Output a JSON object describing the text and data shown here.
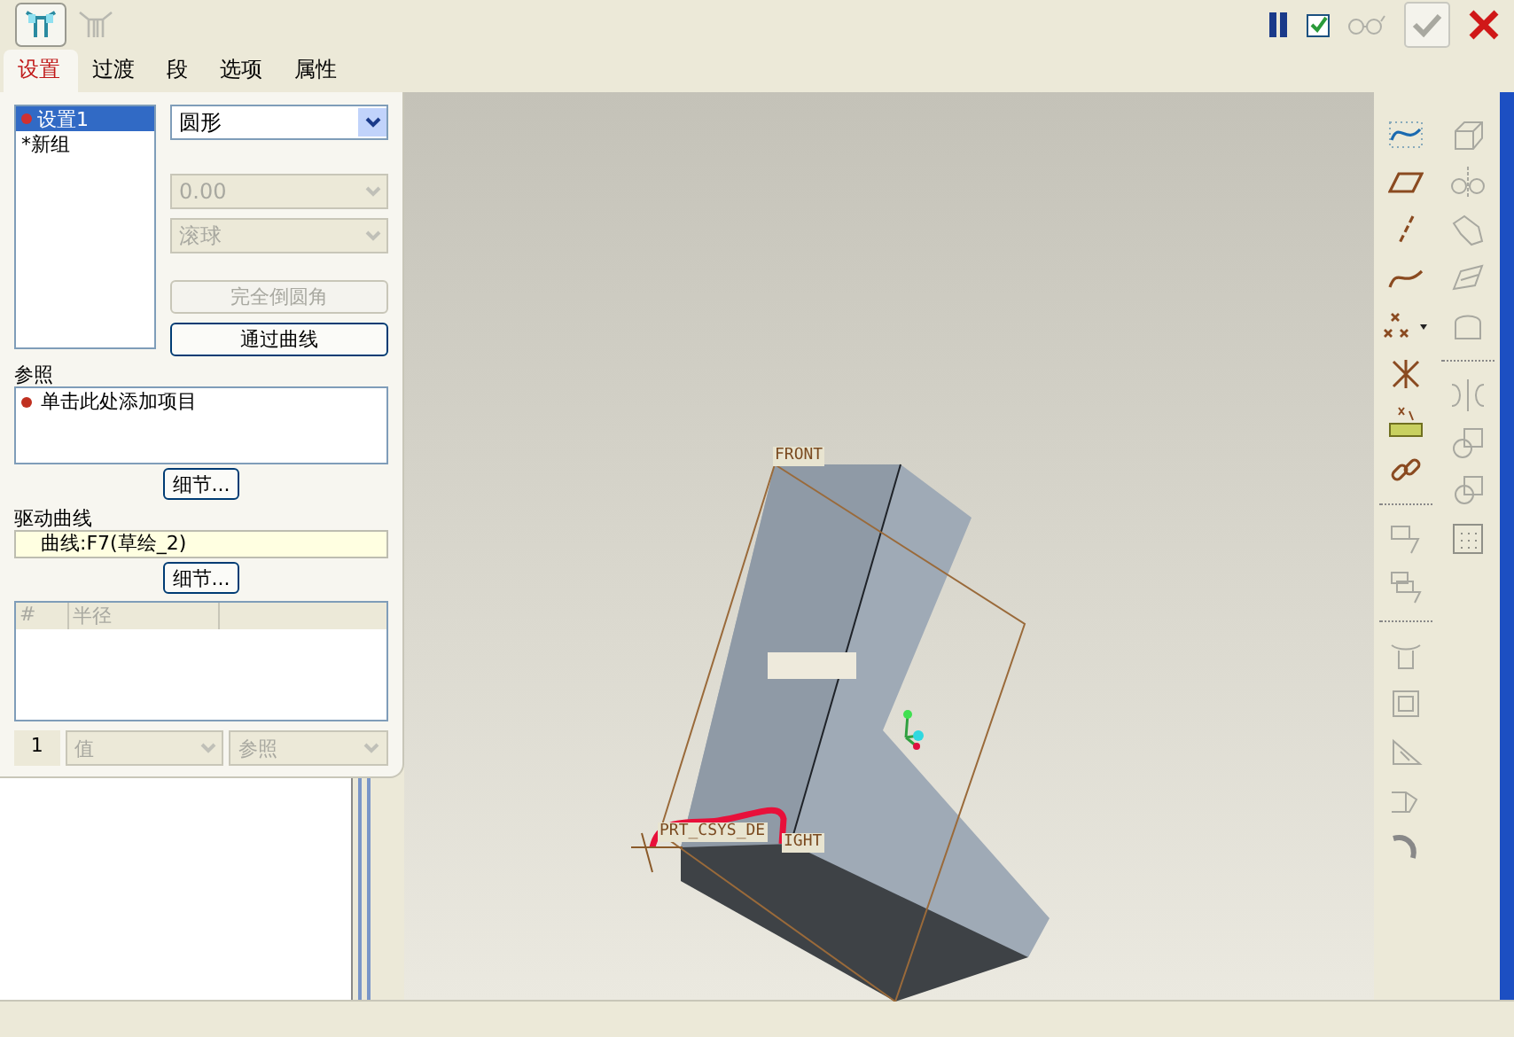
{
  "toolbar": {
    "preview_checked": true
  },
  "tabs": [
    {
      "label": "设置",
      "selected": true
    },
    {
      "label": "过渡",
      "selected": false
    },
    {
      "label": "段",
      "selected": false
    },
    {
      "label": "选项",
      "selected": false
    },
    {
      "label": "属性",
      "selected": false
    }
  ],
  "sets": [
    {
      "label": "设置1",
      "selected": true,
      "kind": "set"
    },
    {
      "label": "*新组",
      "selected": false,
      "kind": "new"
    }
  ],
  "dropdowns": [
    {
      "value": "圆形",
      "disabled": false
    },
    {
      "value": "0.00",
      "disabled": true
    },
    {
      "value": "滚球",
      "disabled": true
    }
  ],
  "buttons": [
    {
      "label": "完全倒圆角",
      "disabled": true
    },
    {
      "label": "通过曲线",
      "disabled": false
    }
  ],
  "references": {
    "label": "参照",
    "items": [
      "单击此处添加项目"
    ],
    "details_button": "细节..."
  },
  "driving_curve": {
    "label": "驱动曲线",
    "value": "曲线:F7(草绘_2)",
    "details_button": "细节..."
  },
  "radius_table": {
    "columns": [
      "#",
      "半径"
    ]
  },
  "bottom_row": {
    "index": "1",
    "value_dropdown": "值",
    "reference_dropdown": "参照"
  },
  "viewport": {
    "labels": [
      "FRONT",
      "PRT_CSYS_DE",
      "IGHT"
    ]
  }
}
